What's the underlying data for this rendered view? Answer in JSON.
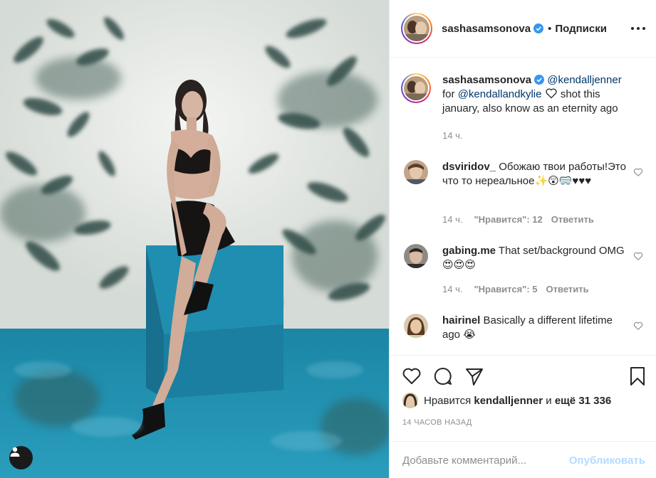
{
  "post": {
    "author": "sashasamsonova",
    "follow_state": "Подписки",
    "dot": "•"
  },
  "caption": {
    "username": "sashasamsonova",
    "mention1": "@kendalljenner",
    "text_for": "for",
    "mention2": "@kendallandkylie",
    "text_rest": " shot this january, also know as an eternity ago",
    "time": "14 ч."
  },
  "comments": [
    {
      "username": "dsviridov_",
      "text": "Обожаю твои работы!Это что то нереальное",
      "emoji_suffix": "✨😲🥽♥♥♥",
      "time": "14 ч.",
      "likes": "\"Нравится\": 12",
      "reply": "Ответить"
    },
    {
      "username": "gabing.me",
      "text": "That set/background OMG",
      "emoji_suffix": "😍😍😍",
      "time": "14 ч.",
      "likes": "\"Нравится\": 5",
      "reply": "Ответить"
    },
    {
      "username": "hairinel",
      "text": "Basically a different lifetime ago",
      "emoji_suffix": "😭"
    }
  ],
  "likes": {
    "prefix": "Нравится",
    "user": "kendalljenner",
    "and": "и",
    "count": "ещё 31 336"
  },
  "time_ago": "14 ЧАСОВ НАЗАД",
  "comment_box": {
    "placeholder": "Добавьте комментарий...",
    "publish": "Опубликовать"
  },
  "icons": {
    "like": "heart-icon",
    "comment": "comment-icon",
    "share": "paper-plane-icon",
    "save": "bookmark-icon",
    "more": "ellipsis-icon",
    "verified": "verified-badge-icon",
    "user_tags": "person-icon"
  },
  "colors": {
    "text": "#262626",
    "muted": "#8e8e8e",
    "mention": "#00376b",
    "verified": "#3897f0",
    "publish_disabled": "#b3dbff",
    "border": "#efefef"
  }
}
